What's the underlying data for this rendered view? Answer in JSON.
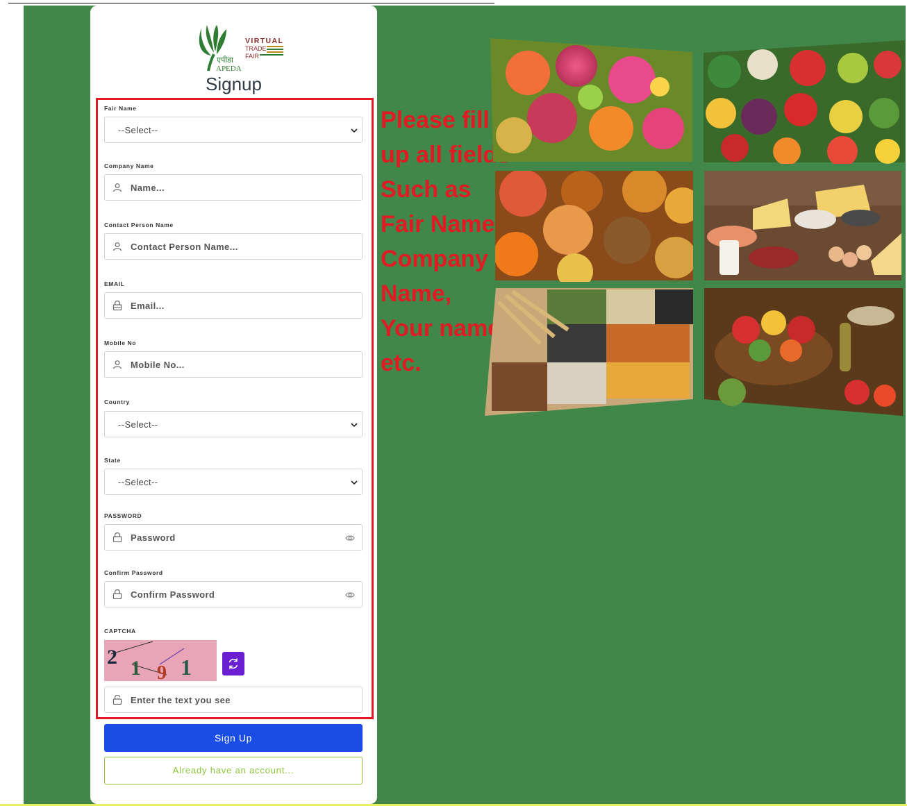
{
  "logo": {
    "line1": "VIRTUAL",
    "line2": "TRADE",
    "line3": "FAIR",
    "hindi": "एपीडा",
    "org": "APEDA"
  },
  "title": "Signup",
  "fields": {
    "fair_name": {
      "label": "Fair Name",
      "value": "--Select--"
    },
    "company_name": {
      "label": "Company Name",
      "placeholder": "Name..."
    },
    "contact_person": {
      "label": "Contact Person Name",
      "placeholder": "Contact Person Name..."
    },
    "email": {
      "label": "EMAIL",
      "placeholder": "Email..."
    },
    "mobile": {
      "label": "Mobile No",
      "placeholder": "Mobile No..."
    },
    "country": {
      "label": "Country",
      "value": "--Select--"
    },
    "state": {
      "label": "State",
      "value": "--Select--"
    },
    "password": {
      "label": "PASSWORD",
      "placeholder": "Password"
    },
    "confirm_password": {
      "label": "Confirm Password",
      "placeholder": "Confirm Password"
    },
    "captcha": {
      "label": "CAPTCHA",
      "code": "21 9 1",
      "placeholder": "Enter the text you see"
    }
  },
  "buttons": {
    "signup": "Sign Up",
    "login": "Already have an account..."
  },
  "annotation": {
    "lines": [
      "Please fill",
      "up all fields",
      "Such as",
      "Fair Name,",
      "Company",
      "Name,",
      "Your name",
      "etc."
    ],
    "color": "#e01b24"
  },
  "colors": {
    "background": "#41874a",
    "primary_button": "#1a4de6",
    "refresh_button": "#6a1fd1",
    "outline_button": "#8cc43c"
  }
}
